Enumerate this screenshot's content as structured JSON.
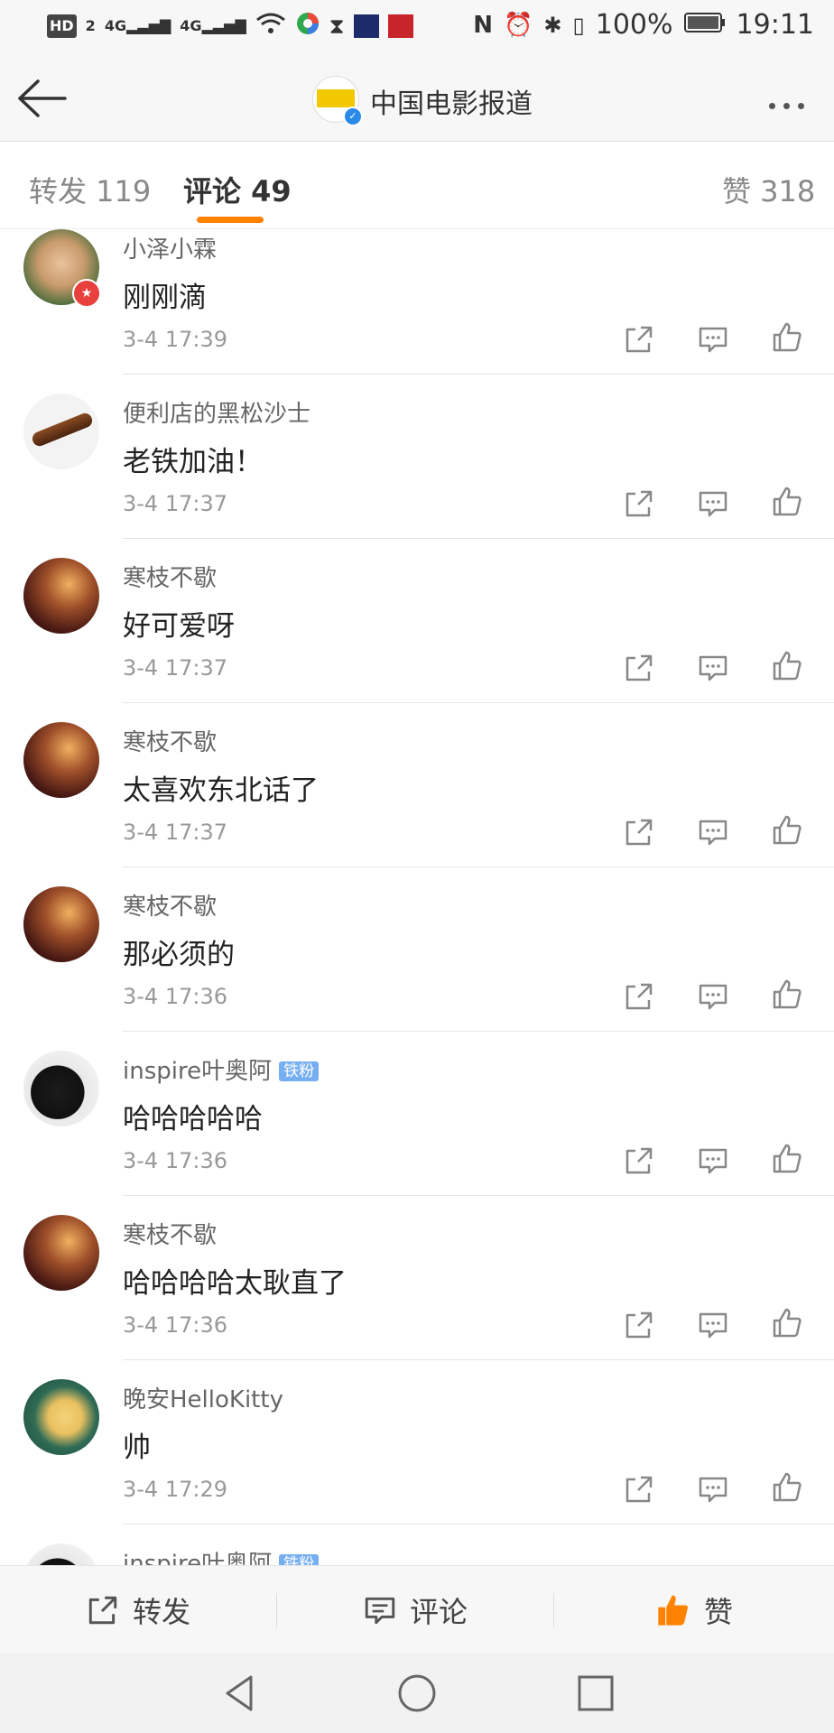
{
  "status_bar": {
    "left_items": [
      "HD",
      "2",
      "4G",
      "4G"
    ],
    "battery": "100%",
    "time": "19:11"
  },
  "header": {
    "back_icon": "arrow-left-icon",
    "title": "中国电影报道",
    "more_icon": "more-dots-icon"
  },
  "tabs": {
    "repost": "转发 119",
    "comment": "评论 49",
    "like": "赞 318"
  },
  "comments": [
    {
      "name": "小泽小霖",
      "badge": "",
      "text": "刚刚滴",
      "time": "3-4 17:39"
    },
    {
      "name": "便利店的黑松沙士",
      "badge": "",
      "text": "老铁加油！",
      "time": "3-4 17:37"
    },
    {
      "name": "寒枝不歇",
      "badge": "",
      "text": "好可爱呀",
      "time": "3-4 17:37"
    },
    {
      "name": "寒枝不歇",
      "badge": "",
      "text": "太喜欢东北话了",
      "time": "3-4 17:37"
    },
    {
      "name": "寒枝不歇",
      "badge": "",
      "text": "那必须的",
      "time": "3-4 17:36"
    },
    {
      "name": "inspire叶奥阿",
      "badge": "铁粉",
      "text": "哈哈哈哈哈",
      "time": "3-4 17:36"
    },
    {
      "name": "寒枝不歇",
      "badge": "",
      "text": "哈哈哈哈太耿直了",
      "time": "3-4 17:36"
    },
    {
      "name": "晚安HelloKitty",
      "badge": "",
      "text": "帅",
      "time": "3-4 17:29"
    },
    {
      "name": "inspire叶奥阿",
      "badge": "铁粉",
      "text": "",
      "time": ""
    }
  ],
  "bottom_bar": {
    "repost": "转发",
    "comment": "评论",
    "like": "赞"
  },
  "colors": {
    "accent": "#ff8200",
    "badge": "#76aef2",
    "verified": "#2b8ae8"
  }
}
